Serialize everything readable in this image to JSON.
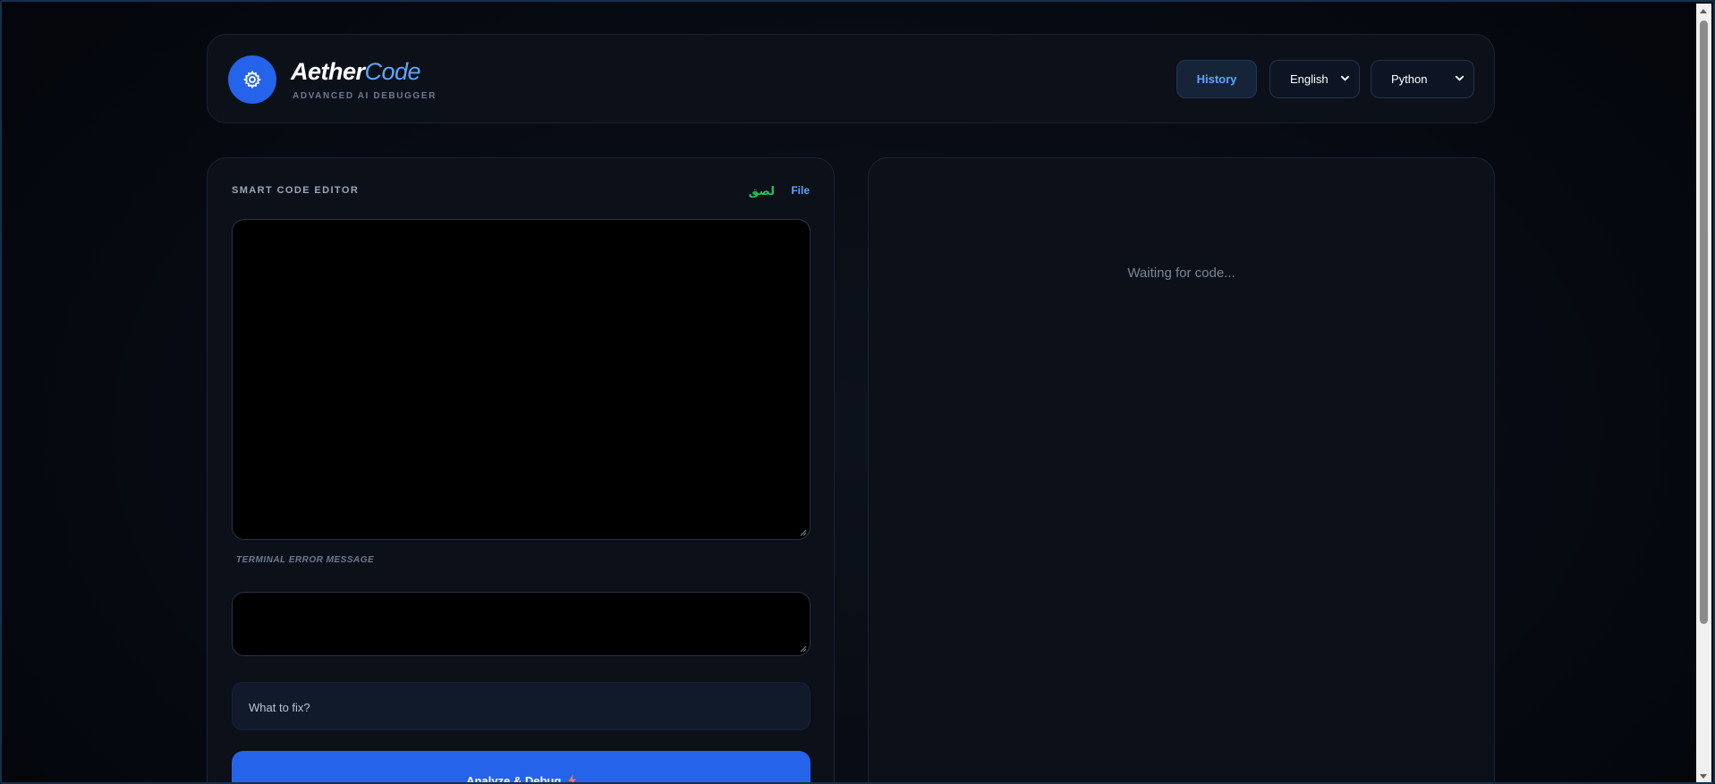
{
  "app": {
    "brand_bold": "Aether",
    "brand_light": "Code",
    "tagline": "ADVANCED AI DEBUGGER"
  },
  "header": {
    "history_label": "History",
    "language_select": {
      "selected": "English"
    },
    "code_language_select": {
      "selected": "Python"
    }
  },
  "editor": {
    "title": "SMART CODE EDITOR",
    "paste_label": "لصق",
    "file_label": "File",
    "code_value": "",
    "error_label": "TERMINAL ERROR MESSAGE",
    "error_value": "",
    "fix_placeholder": "What to fix?",
    "analyze_label": "Analyze & Debug"
  },
  "output": {
    "status_text": "Waiting for code..."
  },
  "colors": {
    "accent": "#2563eb",
    "accent_light": "#60a5fa",
    "paste_green": "#22c55e",
    "background": "#05080f",
    "panel": "#0b1019"
  },
  "icons": {
    "logo": "atom-gear-icon",
    "analyze": "lightning-icon",
    "select_arrow": "chevron-down-icon"
  }
}
